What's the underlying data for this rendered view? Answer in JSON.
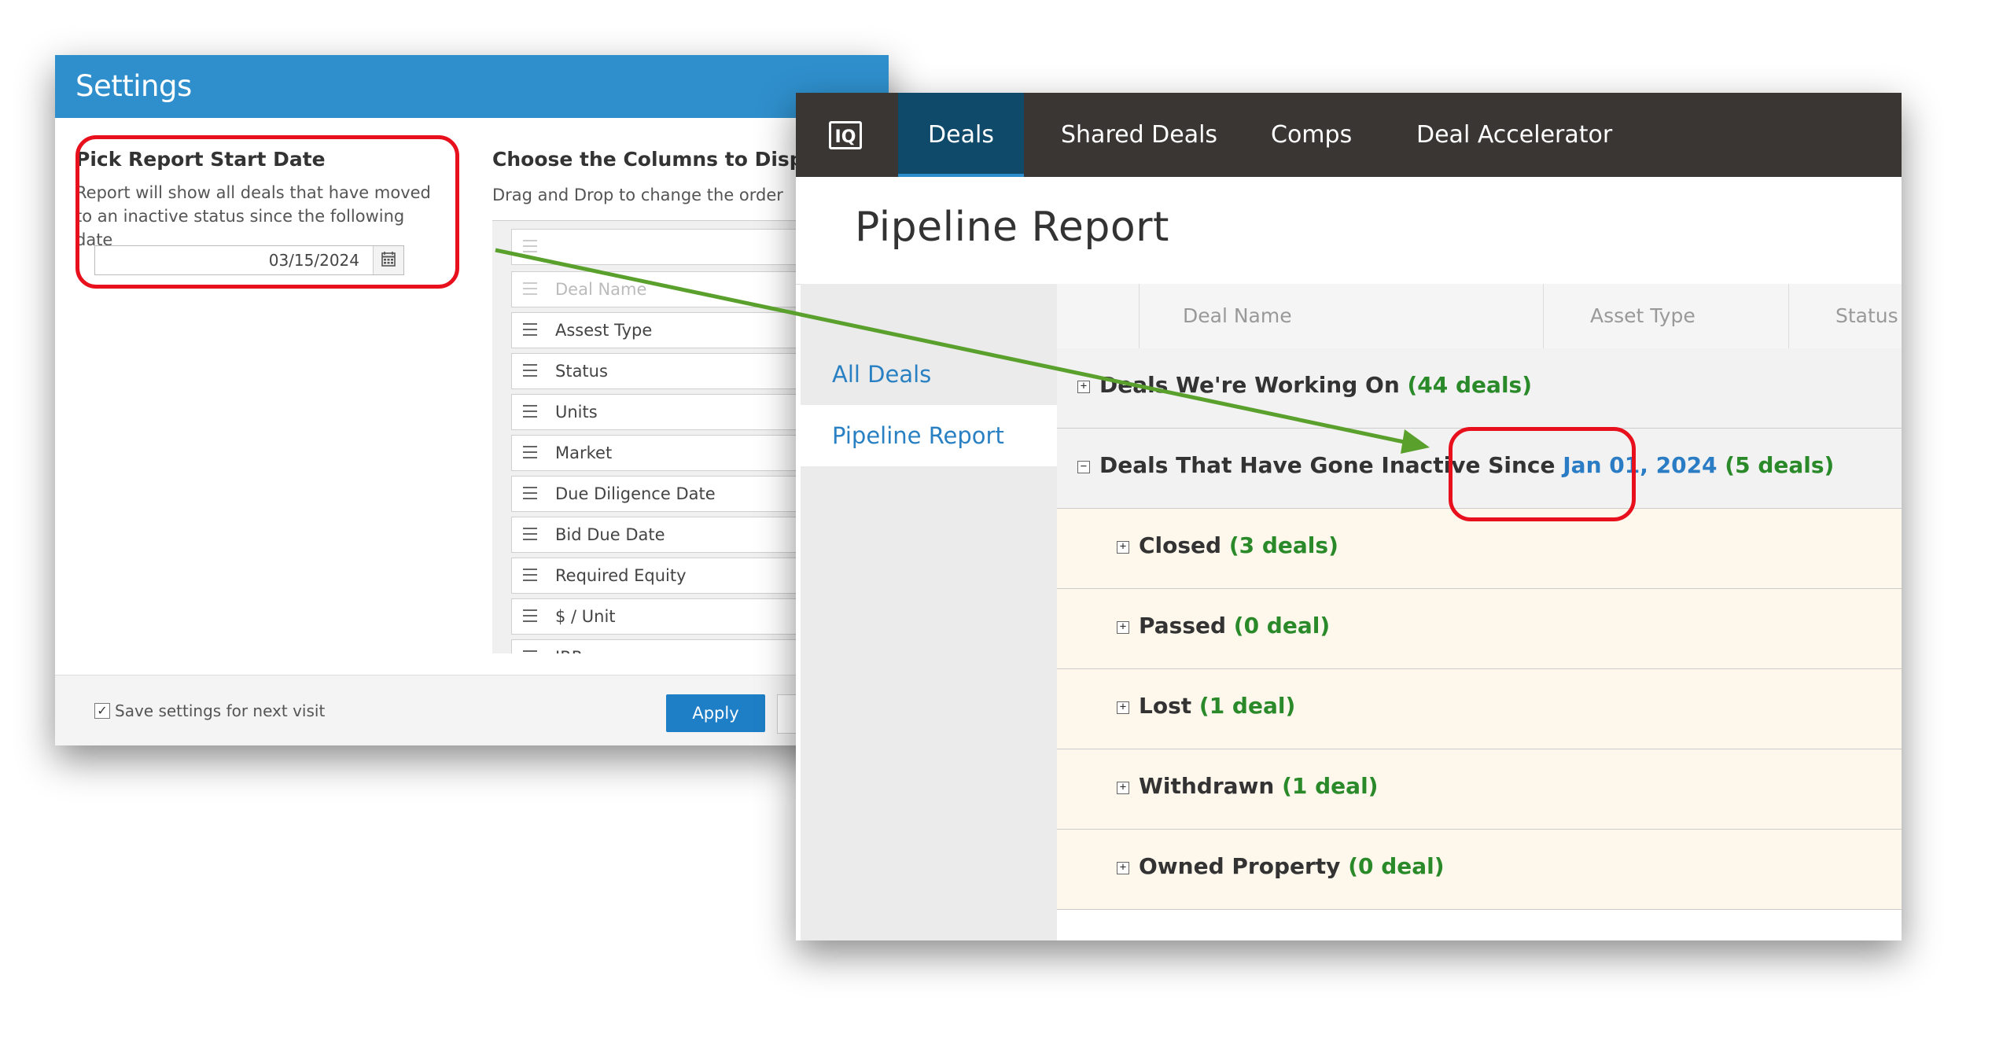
{
  "settings": {
    "title": "Settings",
    "pick_title": "Pick Report Start Date",
    "pick_desc_line1": "Report will show all deals that have moved",
    "pick_desc_line2": "to an inactive status since the following date",
    "start_date": "03/15/2024",
    "columns_title": "Choose the Columns to Displa",
    "columns_sub": "Drag and Drop to change the order",
    "columns": [
      "",
      "Deal Name",
      "Assest Type",
      "Status",
      "Units",
      "Market",
      "Due Diligence Date",
      "Bid Due Date",
      "Required Equity",
      "$ / Unit",
      "IRR"
    ],
    "save_label": "Save settings for next visit",
    "apply_label": "Apply"
  },
  "nav": {
    "logo": "IQ",
    "tabs": [
      "Deals",
      "Shared Deals",
      "Comps",
      "Deal Accelerator"
    ],
    "active_tab": "Deals"
  },
  "page": {
    "title": "Pipeline Report"
  },
  "sidebar": {
    "items": [
      "All Deals",
      "Pipeline Report"
    ],
    "active": "Pipeline Report"
  },
  "table": {
    "headers": [
      "Deal Name",
      "Asset Type",
      "Status"
    ],
    "groups": [
      {
        "label": "Deals We're Working On",
        "count": "(44 deals)",
        "expander": "+"
      },
      {
        "label": "Deals That Have Gone Inactive Since",
        "date": "Jan 01, 2024",
        "count": "(5 deals)",
        "expander": "−"
      }
    ],
    "subgroups": [
      {
        "label": "Closed",
        "count": "(3 deals)"
      },
      {
        "label": "Passed",
        "count": "(0 deal)"
      },
      {
        "label": "Lost",
        "count": "(1 deal)"
      },
      {
        "label": "Withdrawn",
        "count": "(1 deal)"
      },
      {
        "label": "Owned Property",
        "count": "(0 deal)"
      }
    ]
  },
  "colors": {
    "header_blue": "#2f8fcc",
    "nav_dark": "#3a3634",
    "nav_active": "#0f4a6b",
    "count_green": "#2a8a2a",
    "link_blue": "#2a7cc4",
    "highlight_red": "#e8101c",
    "arrow_green": "#5aa02c"
  }
}
